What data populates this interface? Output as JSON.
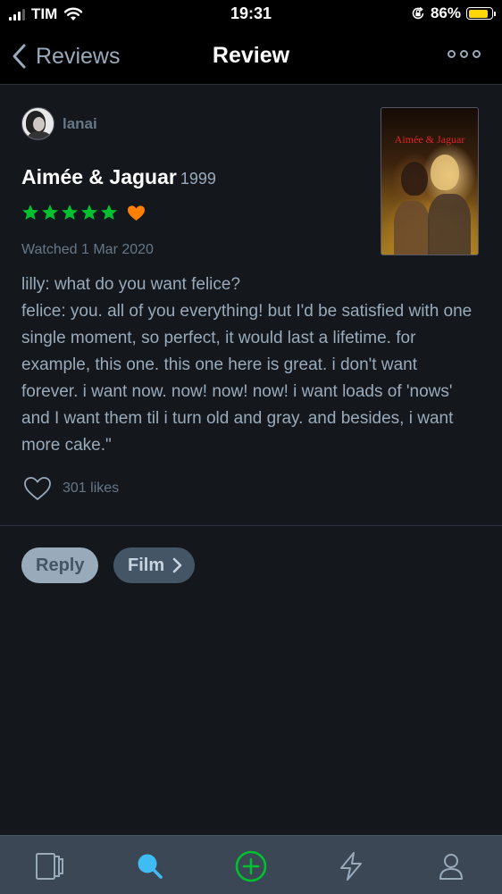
{
  "status_bar": {
    "carrier": "TIM",
    "time": "19:31",
    "battery": "86%",
    "battery_level": 0.86,
    "battery_color": "#ffd60a"
  },
  "nav": {
    "back_label": "Reviews",
    "title": "Review"
  },
  "review": {
    "username": "lanai",
    "film_title": "Aimée & Jaguar",
    "year": "1999",
    "stars": 5,
    "star_color": "#00c030",
    "liked": true,
    "heart_color": "#ff8000",
    "watched": "Watched 1 Mar 2020",
    "poster_title": "Aimée & Jaguar",
    "text_lines": [
      "lilly: what do you want felice?",
      "felice: you. all of you everything! but I'd be satisfied with one single moment, so perfect, it would last a lifetime. for example, this one. this one here is great. i don't want forever. i want now. now! now! now! i want loads of 'nows' and I want them til i turn old and gray. and besides, i want more cake.\""
    ],
    "likes": "301 likes"
  },
  "actions": {
    "reply": "Reply",
    "film": "Film"
  },
  "tab_bar": {
    "items": [
      {
        "icon": "films-icon"
      },
      {
        "icon": "search-icon",
        "active": true,
        "color": "#40bcf4"
      },
      {
        "icon": "add-icon",
        "color": "#00c030"
      },
      {
        "icon": "activity-icon"
      },
      {
        "icon": "profile-icon"
      }
    ]
  }
}
